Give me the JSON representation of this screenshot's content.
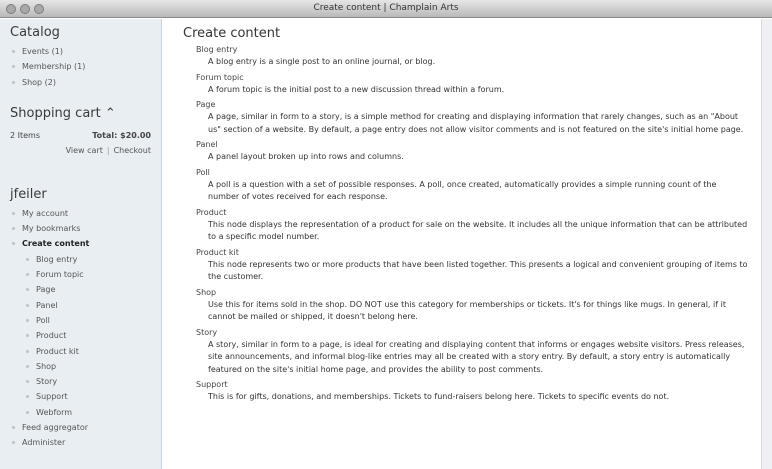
{
  "window": {
    "title": "Create content | Champlain Arts"
  },
  "sidebar": {
    "catalog": {
      "heading": "Catalog",
      "items": [
        {
          "label": "Events (1)"
        },
        {
          "label": "Membership (1)"
        },
        {
          "label": "Shop (2)"
        }
      ]
    },
    "cart": {
      "heading": "Shopping cart ⌃",
      "items_count": "2 Items",
      "total": "Total: $20.00",
      "view_cart": "View cart",
      "separator": "|",
      "checkout": "Checkout"
    },
    "user": {
      "heading": "jfeiler",
      "items": [
        {
          "label": "My account"
        },
        {
          "label": "My bookmarks"
        },
        {
          "label": "Create content"
        },
        {
          "label": "Blog entry"
        },
        {
          "label": "Forum topic"
        },
        {
          "label": "Page"
        },
        {
          "label": "Panel"
        },
        {
          "label": "Poll"
        },
        {
          "label": "Product"
        },
        {
          "label": "Product kit"
        },
        {
          "label": "Shop"
        },
        {
          "label": "Story"
        },
        {
          "label": "Support"
        },
        {
          "label": "Webform"
        },
        {
          "label": "Feed aggregator"
        },
        {
          "label": "Administer"
        }
      ]
    }
  },
  "main": {
    "title": "Create content",
    "entries": [
      {
        "title": "Blog entry",
        "desc": "A blog entry is a single post to an online journal, or blog."
      },
      {
        "title": "Forum topic",
        "desc": "A forum topic is the initial post to a new discussion thread within a forum."
      },
      {
        "title": "Page",
        "desc": "A page, similar in form to a story, is a simple method for creating and displaying information that rarely changes, such as an \"About us\" section of a website. By default, a page entry does not allow visitor comments and is not featured on the site's initial home page."
      },
      {
        "title": "Panel",
        "desc": "A panel layout broken up into rows and columns."
      },
      {
        "title": "Poll",
        "desc": "A poll is a question with a set of possible responses. A poll, once created, automatically provides a simple running count of the number of votes received for each response."
      },
      {
        "title": "Product",
        "desc": "This node displays the representation of a product for sale on the website. It includes all the unique information that can be attributed to a specific model number."
      },
      {
        "title": "Product kit",
        "desc": "This node represents two or more products that have been listed together. This presents a logical and convenient grouping of items to the customer."
      },
      {
        "title": "Shop",
        "desc": "Use this for items sold in the shop. DO NOT use this category for memberships or tickets. It's for things like mugs. In general, if it cannot be mailed or shipped, it doesn't belong here."
      },
      {
        "title": "Story",
        "desc": "A story, similar in form to a page, is ideal for creating and displaying content that informs or engages website visitors. Press releases, site announcements, and informal blog-like entries may all be created with a story entry. By default, a story entry is automatically featured on the site's initial home page, and provides the ability to post comments."
      },
      {
        "title": "Support",
        "desc": "This is for gifts, donations, and memberships. Tickets to fund-raisers belong here. Tickets to specific events do not."
      }
    ]
  }
}
